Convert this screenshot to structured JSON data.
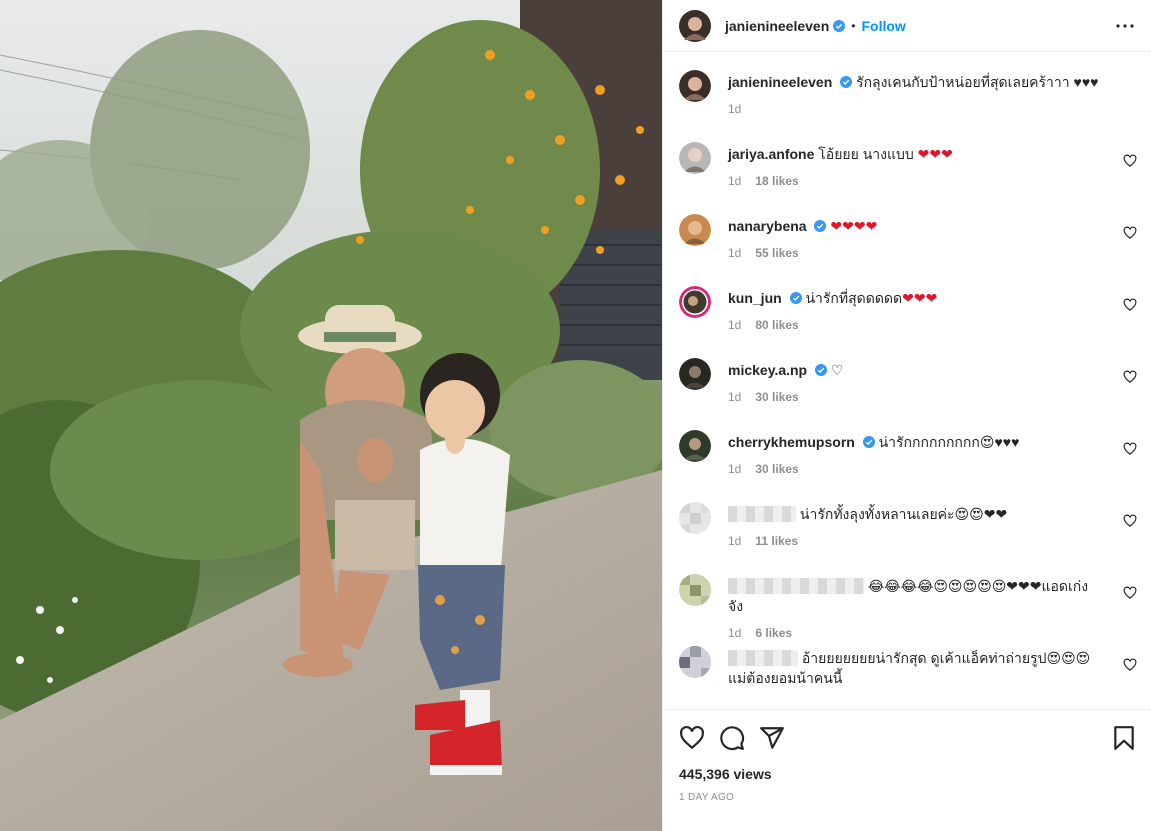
{
  "header": {
    "username": "janienineeleven",
    "dot": "•",
    "follow_label": "Follow",
    "more_icon": "more-horizontal-icon"
  },
  "caption": {
    "username": "janienineeleven",
    "text": "รักลุงเคนกับป้าหน่อยที่สุดเลยคร้าาา ♥♥♥",
    "time": "1d"
  },
  "comments": [
    {
      "username": "jariya.anfone",
      "verified": false,
      "text": "โอ้ยยย นางแบบ ",
      "emoji": "❤❤❤",
      "time": "1d",
      "likes": "18 likes"
    },
    {
      "username": "nanarybena",
      "verified": true,
      "text": "",
      "emoji": "❤❤❤❤",
      "time": "1d",
      "likes": "55 likes"
    },
    {
      "username": "kun_jun",
      "verified": true,
      "text": "น่ารักที่สุดดดดด",
      "emoji": "❤❤❤",
      "time": "1d",
      "likes": "80 likes"
    },
    {
      "username": "mickey.a.np",
      "verified": true,
      "text": "♡",
      "emoji": "",
      "time": "1d",
      "likes": "30 likes"
    },
    {
      "username": "cherrykhemupsorn",
      "verified": true,
      "text": "น่ารักกกกกกกกก😍♥♥♥",
      "emoji": "",
      "time": "1d",
      "likes": "30 likes"
    },
    {
      "username": "",
      "verified": false,
      "text": "น่ารักทั้งลุงทั้งหลานเลยค่ะ😍😍❤❤",
      "emoji": "",
      "time": "1d",
      "likes": "11 likes"
    },
    {
      "username": "",
      "verified": false,
      "text": "😂😂😂😂😍😍😍😍😍❤❤❤แอดเก่งจัง",
      "emoji": "",
      "time": "1d",
      "likes": "6 likes"
    },
    {
      "username": "",
      "verified": false,
      "text": "อ้ายยยยยยยน่ารักสุด ดูเค้าแอ็คท่าถ่ายรูป😍😍😍แม่ต้องยอมน้าคนนี้",
      "emoji": "",
      "time": "",
      "likes": ""
    }
  ],
  "actions": {
    "like_icon": "heart-icon",
    "comment_icon": "comment-icon",
    "share_icon": "send-icon",
    "save_icon": "bookmark-icon",
    "views": "445,396 views",
    "timestamp": "1 DAY AGO"
  },
  "colors": {
    "accent": "#0095f6",
    "verified": "#3897f0",
    "muted": "#8e8e8e",
    "text": "#262626"
  }
}
